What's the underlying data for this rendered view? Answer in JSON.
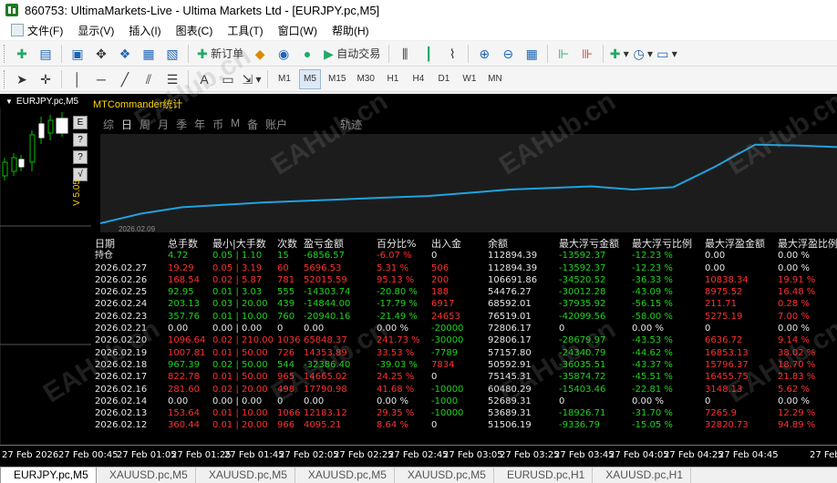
{
  "window": {
    "title": "860753: UltimaMarkets-Live - Ultima Markets Ltd - [EURJPY.pc,M5]"
  },
  "menu": [
    {
      "label": "文件(F)",
      "icon": "file-menu-icon"
    },
    {
      "label": "显示(V)"
    },
    {
      "label": "插入(I)"
    },
    {
      "label": "图表(C)"
    },
    {
      "label": "工具(T)"
    },
    {
      "label": "窗口(W)"
    },
    {
      "label": "帮助(H)"
    }
  ],
  "toolbar": {
    "new_order": "新订单",
    "auto_trading": "自动交易"
  },
  "timeframes": [
    "M1",
    "M5",
    "M15",
    "M30",
    "H1",
    "H4",
    "D1",
    "W1",
    "MN"
  ],
  "active_timeframe": "M5",
  "chart": {
    "symbol_caption": "EURJPY.pc,M5",
    "version": "V 5.05",
    "side_buttons": [
      "E",
      "?",
      "?",
      "√"
    ]
  },
  "panel": {
    "title": "MTCommander统计",
    "tabs": [
      "综",
      "日",
      "周",
      "月",
      "季",
      "年",
      "币",
      "M",
      "备",
      "账户"
    ],
    "active_tab": "日",
    "track_tab": "轨迹",
    "equity_start_date": "2026.02.09",
    "equity_line_color": "#1fa3e0",
    "equity_curve": [
      0,
      0.12,
      0.2,
      0.23,
      0.26,
      0.28,
      0.3,
      0.32,
      0.34,
      0.38,
      0.42,
      0.44,
      0.46,
      0.42,
      0.45,
      0.7,
      0.98,
      0.97,
      0.95
    ]
  },
  "stats": {
    "headers": [
      "日期",
      "总手数",
      "最小|大手数",
      "次数",
      "盈亏金额",
      "百分比%",
      "出入金",
      "余额",
      "最大浮亏金额",
      "最大浮亏比例",
      "最大浮盈金额",
      "最大浮盈比例"
    ],
    "rows": [
      {
        "date": "持仓",
        "lots": "4.72",
        "minmax": "0.05 | 1.10",
        "count": "15",
        "pnl": "-6856.57",
        "pct": "-6.07 %",
        "io": "0",
        "balance": "112894.39",
        "maxloss": "-13592.37",
        "maxlossp": "-12.23 %",
        "maxprofit": "0.00",
        "maxprofitp": "0.00 %",
        "colors": [
          "w",
          "g",
          "g",
          "g",
          "g",
          "r",
          "w",
          "w",
          "g",
          "g",
          "w",
          "w"
        ]
      },
      {
        "date": "2026.02.27",
        "lots": "19.29",
        "minmax": "0.05 | 3.19",
        "count": "60",
        "pnl": "5696.53",
        "pct": "5.31 %",
        "io": "506",
        "balance": "112894.39",
        "maxloss": "-13592.37",
        "maxlossp": "-12.23 %",
        "maxprofit": "0.00",
        "maxprofitp": "0.00 %",
        "colors": [
          "w",
          "r",
          "r",
          "r",
          "r",
          "r",
          "r",
          "w",
          "g",
          "g",
          "w",
          "w"
        ]
      },
      {
        "date": "2026.02.26",
        "lots": "168.54",
        "minmax": "0.02 | 5.87",
        "count": "781",
        "pnl": "52015.59",
        "pct": "95.13 %",
        "io": "200",
        "balance": "106691.86",
        "maxloss": "-34520.52",
        "maxlossp": "-36.33 %",
        "maxprofit": "10838.34",
        "maxprofitp": "19.91 %",
        "colors": [
          "w",
          "r",
          "r",
          "r",
          "r",
          "r",
          "r",
          "w",
          "g",
          "g",
          "r",
          "r"
        ]
      },
      {
        "date": "2026.02.25",
        "lots": "92.95",
        "minmax": "0.01 | 3.03",
        "count": "555",
        "pnl": "-14303.74",
        "pct": "-20.80 %",
        "io": "188",
        "balance": "54476.27",
        "maxloss": "-30012.28",
        "maxlossp": "-43.09 %",
        "maxprofit": "8975.52",
        "maxprofitp": "16.48 %",
        "colors": [
          "w",
          "g",
          "g",
          "g",
          "g",
          "g",
          "r",
          "w",
          "g",
          "g",
          "r",
          "r"
        ]
      },
      {
        "date": "2026.02.24",
        "lots": "203.13",
        "minmax": "0.03 | 20.00",
        "count": "439",
        "pnl": "-14844.00",
        "pct": "-17.79 %",
        "io": "6917",
        "balance": "68592.01",
        "maxloss": "-37935.92",
        "maxlossp": "-56.15 %",
        "maxprofit": "211.71",
        "maxprofitp": "0.28 %",
        "colors": [
          "w",
          "g",
          "g",
          "g",
          "g",
          "g",
          "r",
          "w",
          "g",
          "g",
          "r",
          "r"
        ]
      },
      {
        "date": "2026.02.23",
        "lots": "357.76",
        "minmax": "0.01 | 10.00",
        "count": "760",
        "pnl": "-20940.16",
        "pct": "-21.49 %",
        "io": "24653",
        "balance": "76519.01",
        "maxloss": "-42099.56",
        "maxlossp": "-58.00 %",
        "maxprofit": "5275.19",
        "maxprofitp": "7.00 %",
        "colors": [
          "w",
          "g",
          "g",
          "g",
          "g",
          "g",
          "r",
          "w",
          "g",
          "g",
          "r",
          "r"
        ]
      },
      {
        "date": "2026.02.21",
        "lots": "0.00",
        "minmax": "0.00 | 0.00",
        "count": "0",
        "pnl": "0.00",
        "pct": "0.00 %",
        "io": "-20000",
        "balance": "72806.17",
        "maxloss": "0",
        "maxlossp": "0.00 %",
        "maxprofit": "0",
        "maxprofitp": "0.00 %",
        "colors": [
          "w",
          "w",
          "w",
          "w",
          "w",
          "w",
          "g",
          "w",
          "w",
          "w",
          "w",
          "w"
        ]
      },
      {
        "date": "2026.02.20",
        "lots": "1096.64",
        "minmax": "0.02 | 210.00",
        "count": "1036",
        "pnl": "65848.37",
        "pct": "241.73 %",
        "io": "-30000",
        "balance": "92806.17",
        "maxloss": "-28679.97",
        "maxlossp": "-43.53 %",
        "maxprofit": "6636.72",
        "maxprofitp": "9.14 %",
        "colors": [
          "w",
          "r",
          "r",
          "r",
          "r",
          "r",
          "g",
          "w",
          "g",
          "g",
          "r",
          "r"
        ]
      },
      {
        "date": "2026.02.19",
        "lots": "1007.81",
        "minmax": "0.01 | 50.00",
        "count": "726",
        "pnl": "14353.89",
        "pct": "33.53 %",
        "io": "-7789",
        "balance": "57157.80",
        "maxloss": "-24340.79",
        "maxlossp": "-44.62 %",
        "maxprofit": "16853.13",
        "maxprofitp": "38.02 %",
        "colors": [
          "w",
          "r",
          "r",
          "r",
          "r",
          "r",
          "g",
          "w",
          "g",
          "g",
          "r",
          "r"
        ]
      },
      {
        "date": "2026.02.18",
        "lots": "967.39",
        "minmax": "0.02 | 50.00",
        "count": "544",
        "pnl": "-32386.40",
        "pct": "-39.03 %",
        "io": "7834",
        "balance": "50592.91",
        "maxloss": "-36035.51",
        "maxlossp": "-43.37 %",
        "maxprofit": "15796.37",
        "maxprofitp": "18.70 %",
        "colors": [
          "w",
          "g",
          "g",
          "g",
          "g",
          "g",
          "r",
          "w",
          "g",
          "g",
          "r",
          "r"
        ]
      },
      {
        "date": "2026.02.17",
        "lots": "822.78",
        "minmax": "0.01 | 50.00",
        "count": "965",
        "pnl": "14665.02",
        "pct": "24.25 %",
        "io": "0",
        "balance": "75145.31",
        "maxloss": "-35874.72",
        "maxlossp": "-45.51 %",
        "maxprofit": "16455.75",
        "maxprofitp": "21.83 %",
        "colors": [
          "w",
          "r",
          "r",
          "r",
          "r",
          "r",
          "w",
          "w",
          "g",
          "g",
          "r",
          "r"
        ]
      },
      {
        "date": "2026.02.16",
        "lots": "281.60",
        "minmax": "0.02 | 20.00",
        "count": "498",
        "pnl": "17790.98",
        "pct": "41.68 %",
        "io": "-10000",
        "balance": "60480.29",
        "maxloss": "-15403.46",
        "maxlossp": "-22.81 %",
        "maxprofit": "3148.13",
        "maxprofitp": "5.62 %",
        "colors": [
          "w",
          "r",
          "r",
          "r",
          "r",
          "r",
          "g",
          "w",
          "g",
          "g",
          "r",
          "r"
        ]
      },
      {
        "date": "2026.02.14",
        "lots": "0.00",
        "minmax": "0.00 | 0.00",
        "count": "0",
        "pnl": "0.00",
        "pct": "0.00 %",
        "io": "-1000",
        "balance": "52689.31",
        "maxloss": "0",
        "maxlossp": "0.00 %",
        "maxprofit": "0",
        "maxprofitp": "0.00 %",
        "colors": [
          "w",
          "w",
          "w",
          "w",
          "w",
          "w",
          "g",
          "w",
          "w",
          "w",
          "w",
          "w"
        ]
      },
      {
        "date": "2026.02.13",
        "lots": "153.64",
        "minmax": "0.01 | 10.00",
        "count": "1066",
        "pnl": "12183.12",
        "pct": "29.35 %",
        "io": "-10000",
        "balance": "53689.31",
        "maxloss": "-18926.71",
        "maxlossp": "-31.70 %",
        "maxprofit": "7265.9",
        "maxprofitp": "12.29 %",
        "colors": [
          "w",
          "r",
          "r",
          "r",
          "r",
          "r",
          "g",
          "w",
          "g",
          "g",
          "r",
          "r"
        ]
      },
      {
        "date": "2026.02.12",
        "lots": "360.44",
        "minmax": "0.01 | 20.00",
        "count": "966",
        "pnl": "4095.21",
        "pct": "8.64 %",
        "io": "0",
        "balance": "51506.19",
        "maxloss": "-9336.79",
        "maxlossp": "-15.05 %",
        "maxprofit": "32820.73",
        "maxprofitp": "94.89 %",
        "colors": [
          "w",
          "r",
          "r",
          "r",
          "r",
          "r",
          "w",
          "w",
          "g",
          "g",
          "r",
          "r"
        ]
      }
    ]
  },
  "time_axis": [
    "27 Feb 2026",
    "27 Feb 00:45",
    "27 Feb 01:05",
    "27 Feb 01:25",
    "27 Feb 01:45",
    "27 Feb 02:05",
    "27 Feb 02:25",
    "27 Feb 02:45",
    "27 Feb 03:05",
    "27 Feb 03:25",
    "27 Feb 03:45",
    "27 Feb 04:05",
    "27 Feb 04:25",
    "27 Feb 04:45",
    "27 Feb"
  ],
  "tabs": [
    {
      "label": "EURJPY.pc,M5",
      "active": true
    },
    {
      "label": "XAUUSD.pc,M5"
    },
    {
      "label": "XAUUSD.pc,M5"
    },
    {
      "label": "XAUUSD.pc,M5"
    },
    {
      "label": "XAUUSD.pc,M5"
    },
    {
      "label": "EURUSD.pc,H1"
    },
    {
      "label": "XAUUSD.pc,H1"
    }
  ],
  "watermark": "EAHub.cn"
}
